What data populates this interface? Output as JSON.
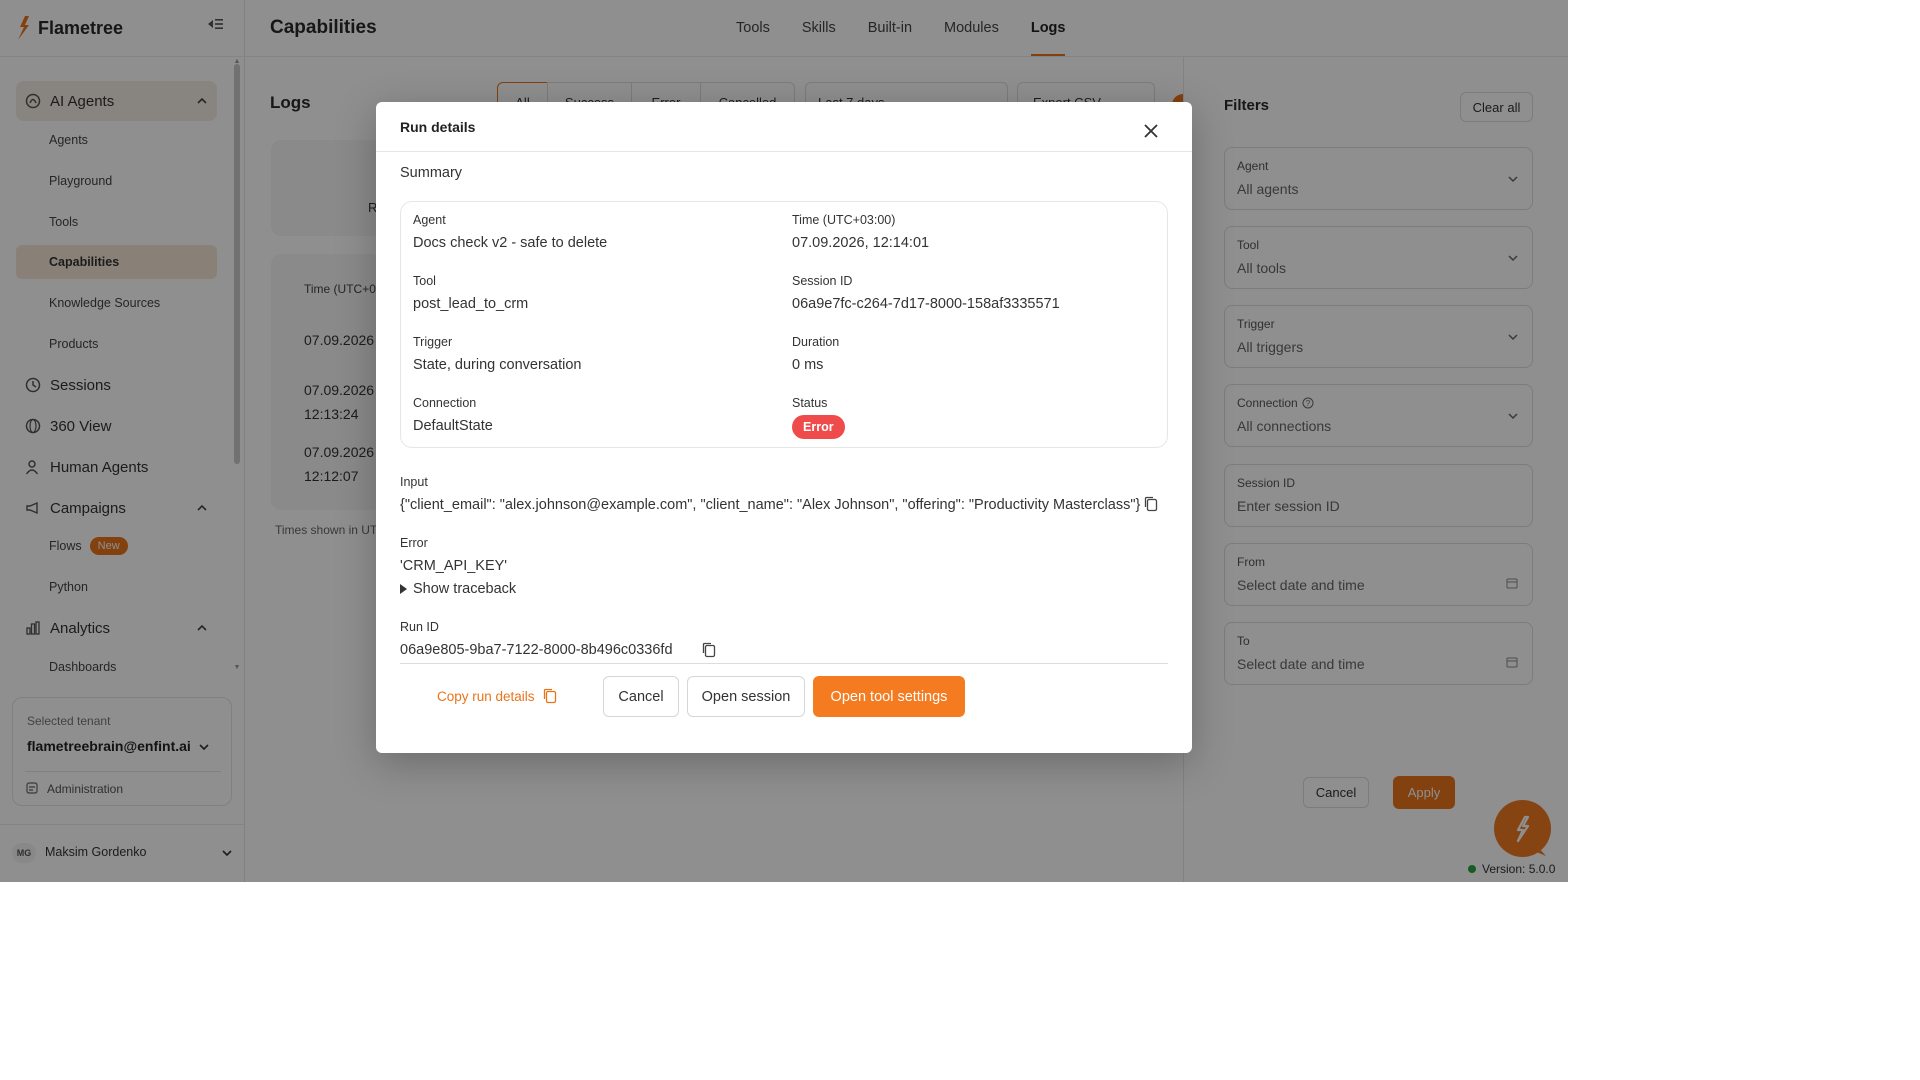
{
  "app": {
    "brand": "Flametree",
    "accent_color": "#e8741c",
    "version": "Version: 5.0.0"
  },
  "sidebar": {
    "groups": {
      "ai_agents": {
        "label": "AI Agents",
        "icon": "agent-icon"
      },
      "sessions": {
        "label": "Sessions",
        "icon": "clock-icon"
      },
      "view360": {
        "label": "360 View",
        "icon": "globe-icon"
      },
      "human_agents": {
        "label": "Human Agents",
        "icon": "person-icon"
      },
      "campaigns": {
        "label": "Campaigns",
        "icon": "megaphone-icon"
      },
      "analytics": {
        "label": "Analytics",
        "icon": "bar-chart-icon"
      }
    },
    "ai_agents_items": [
      "Agents",
      "Playground",
      "Tools",
      "Capabilities",
      "Knowledge Sources",
      "Products"
    ],
    "campaigns_items": {
      "flows": "Flows",
      "flows_badge": "New",
      "python": "Python"
    },
    "analytics_items": [
      "Dashboards"
    ],
    "tenant": {
      "label": "Selected tenant",
      "value": "flametreebrain@enfint.ai",
      "admin": "Administration"
    },
    "user": {
      "initials": "MG",
      "name": "Maksim Gordenko"
    }
  },
  "header": {
    "title": "Capabilities",
    "tabs": [
      "Tools",
      "Skills",
      "Built-in",
      "Modules",
      "Logs"
    ],
    "active_tab": "Logs"
  },
  "logs": {
    "title": "Logs",
    "segments": [
      "All",
      "Success",
      "Error",
      "Cancelled"
    ],
    "range": "Last 7 days",
    "export": "Export CSV",
    "card_letter": "R",
    "table_header_time": "Time (UTC+0",
    "rows": [
      {
        "line1": "07.09.2026",
        "line2": ""
      },
      {
        "line1": "07.09.2026",
        "line2": "12:13:24"
      },
      {
        "line1": "07.09.2026",
        "line2": "12:12:07"
      }
    ],
    "note": "Times shown in UT"
  },
  "filters": {
    "title": "Filters",
    "clear_all": "Clear all",
    "fields": {
      "agent": {
        "label": "Agent",
        "value": "All agents"
      },
      "tool": {
        "label": "Tool",
        "value": "All tools"
      },
      "trigger": {
        "label": "Trigger",
        "value": "All triggers"
      },
      "connection": {
        "label": "Connection",
        "value": "All connections"
      },
      "session": {
        "label": "Session ID",
        "placeholder": "Enter session ID"
      },
      "from": {
        "label": "From",
        "placeholder": "Select date and time"
      },
      "to": {
        "label": "To",
        "placeholder": "Select date and time"
      }
    },
    "cancel": "Cancel",
    "apply": "Apply"
  },
  "modal": {
    "title": "Run details",
    "summary_title": "Summary",
    "summary": {
      "agent": {
        "label": "Agent",
        "value": "Docs check v2 - safe to delete"
      },
      "time": {
        "label": "Time (UTC+03:00)",
        "value": "07.09.2026, 12:14:01"
      },
      "tool": {
        "label": "Tool",
        "value": "post_lead_to_crm"
      },
      "session": {
        "label": "Session ID",
        "value": "06a9e7fc-c264-7d17-8000-158af3335571"
      },
      "trigger": {
        "label": "Trigger",
        "value": "State, during conversation"
      },
      "duration": {
        "label": "Duration",
        "value": "0 ms"
      },
      "connection": {
        "label": "Connection",
        "value": "DefaultState"
      },
      "status": {
        "label": "Status",
        "value": "Error",
        "color": "#ef4b4b"
      }
    },
    "input": {
      "label": "Input",
      "value": "{\"client_email\": \"alex.johnson@example.com\", \"client_name\": \"Alex Johnson\", \"offering\": \"Productivity Masterclass\"}"
    },
    "error": {
      "label": "Error",
      "value": "'CRM_API_KEY'",
      "traceback": "Show traceback"
    },
    "run_id": {
      "label": "Run ID",
      "value": "06a9e805-9ba7-7122-8000-8b496c0336fd"
    },
    "footer": {
      "copy_run": "Copy run details",
      "cancel": "Cancel",
      "open_session": "Open session",
      "open_tool": "Open tool settings"
    }
  }
}
